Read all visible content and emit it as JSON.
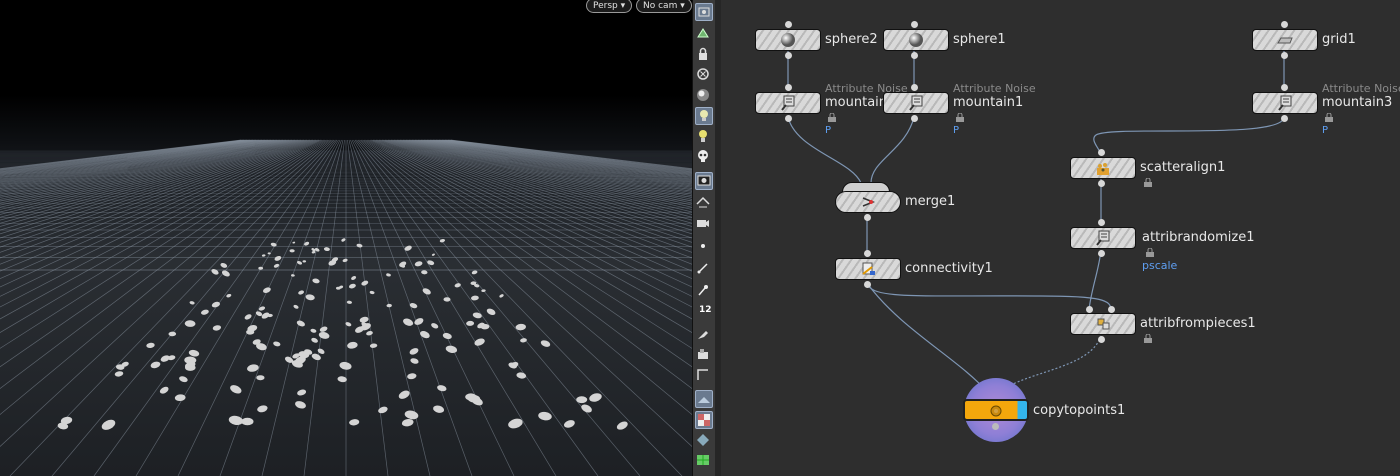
{
  "viewport": {
    "camera_menu": "Persp",
    "cam_menu": "No cam",
    "dropdown_icon": "caret-down-icon"
  },
  "toolbar": {
    "tools": [
      "view-icon",
      "select-icon",
      "lock-icon",
      "snap-icon",
      "shade-icon",
      "light-icon",
      "light-link-icon",
      "skull-icon",
      "display-icon",
      "flip-icon",
      "camera-icon",
      "point-icon",
      "normal-icon",
      "pin-icon",
      "number-icon",
      "paint-icon",
      "ghost-icon",
      "frame-icon",
      "shaded-icon",
      "checker-icon",
      "diamond-icon",
      "grid-icon"
    ],
    "point_number_label": "12"
  },
  "network": {
    "nodes": {
      "sphere2": {
        "label": "sphere2",
        "icon": "sphere-icon"
      },
      "sphere1": {
        "label": "sphere1",
        "icon": "sphere-icon"
      },
      "grid1": {
        "label": "grid1",
        "icon": "grid-icon"
      },
      "mountain_a": {
        "label": "mountain",
        "type": "Attribute Noise",
        "flag": "P",
        "icon": "noise-icon"
      },
      "mountain1": {
        "label": "mountain1",
        "type": "Attribute Noise",
        "flag": "P",
        "icon": "noise-icon"
      },
      "mountain3": {
        "label": "mountain3",
        "type": "Attribute Noise",
        "flag": "P",
        "icon": "noise-icon"
      },
      "merge1": {
        "label": "merge1",
        "icon": "merge-icon"
      },
      "connectivity1": {
        "label": "connectivity1",
        "icon": "connectivity-icon"
      },
      "scatteralign1": {
        "label": "scatteralign1",
        "icon": "scatter-icon"
      },
      "attribrandomize1": {
        "label": "attribrandomize1",
        "flag": "pscale",
        "icon": "randomize-icon"
      },
      "attribfrompieces1": {
        "label": "attribfrompieces1",
        "icon": "pieces-icon"
      },
      "copytopoints1": {
        "label": "copytopoints1",
        "icon": "copy-icon"
      }
    },
    "colors": {
      "wire": "#7e96b4",
      "flag": "#5f9ff2",
      "copy_node": "#f0a10a",
      "copy_ring": "#7f7fd4"
    }
  }
}
